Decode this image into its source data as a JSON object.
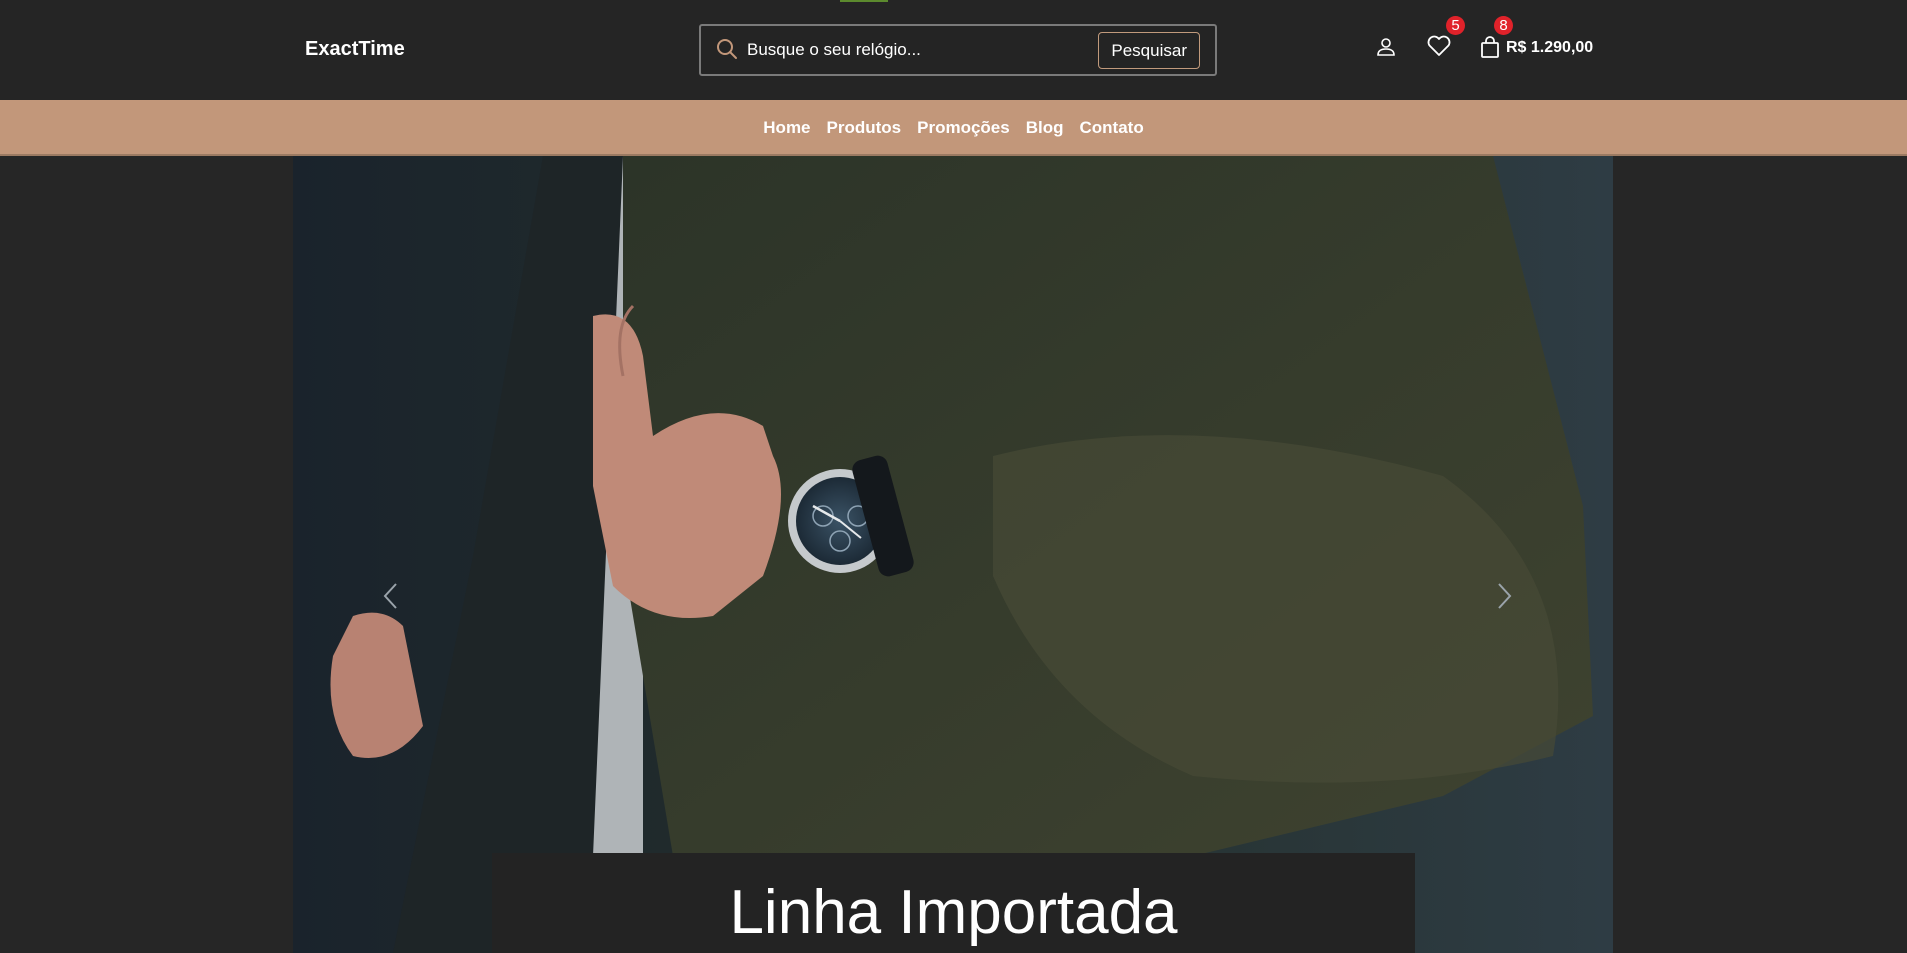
{
  "header": {
    "logo": "ExactTime",
    "search": {
      "placeholder": "Busque o seu relógio...",
      "button_label": "Pesquisar"
    },
    "wishlist_count": "5",
    "cart_count": "8",
    "cart_total": "R$ 1.290,00"
  },
  "nav": {
    "items": [
      "Home",
      "Produtos",
      "Promoções",
      "Blog",
      "Contato"
    ]
  },
  "hero": {
    "caption": "Linha Importada"
  },
  "colors": {
    "background": "#262626",
    "navbar": "#c2977a",
    "badge": "#e0222a",
    "search_button_border": "#c19a7c"
  },
  "icons": [
    "search-icon",
    "user-icon",
    "heart-icon",
    "shopping-bag-icon",
    "chevron-left-icon",
    "chevron-right-icon"
  ]
}
